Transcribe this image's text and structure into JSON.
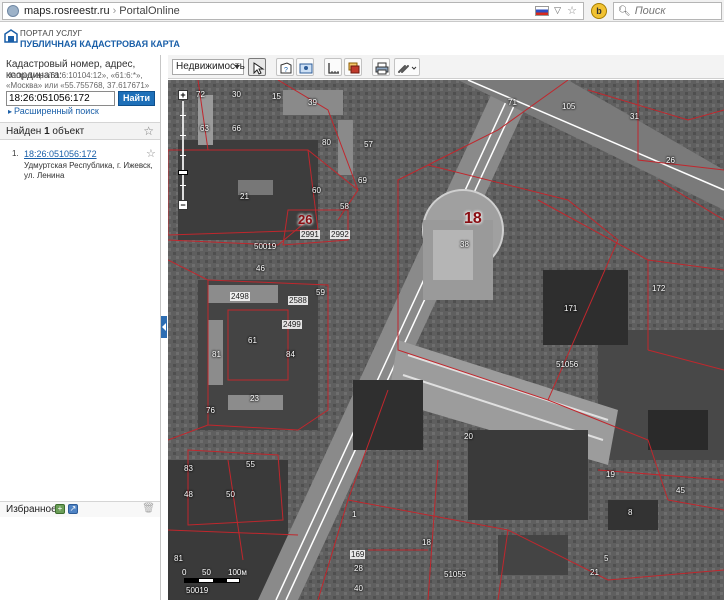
{
  "browser": {
    "url": "maps.rosreestr.ru",
    "page_title": "PortalOnline",
    "search_placeholder": "Поиск"
  },
  "header": {
    "portal_label": "ПОРТАЛ УСЛУГ",
    "title": "ПУБЛИЧНАЯ КАДАСТРОВАЯ КАРТА"
  },
  "search": {
    "hint_title": "Кадастровый номер, адрес, координата:",
    "hint_example": "Например «61:6:10104:12», «61:6:*», «Москва» или «55.755768, 37.617671»",
    "value": "18:26:051056:172",
    "find_label": "Найти",
    "advanced_label": "Расширенный поиск"
  },
  "results": {
    "found_prefix": "Найден",
    "found_count": "1",
    "found_suffix": "объект",
    "items": [
      {
        "num": "1.",
        "cadastral": "18:26:051056:172",
        "address": "Удмуртская Республика, г. Ижевск, ул. Ленина"
      }
    ]
  },
  "favorites": {
    "label": "Избранное"
  },
  "toolbar": {
    "layer_select": "Недвижимость"
  },
  "map": {
    "scale": {
      "l0": "0",
      "l1": "50",
      "l2": "100м"
    },
    "labels": {
      "n72": "72",
      "n30": "30",
      "n15": "15",
      "n39": "39",
      "n71": "71",
      "n105": "105",
      "n31": "31",
      "n63": "63",
      "n66": "66",
      "n80": "80",
      "n57": "57",
      "n26a": "26",
      "n21a": "21",
      "n69": "69",
      "n60": "60",
      "n58": "58",
      "big26": "26",
      "n2991": "2991",
      "n2992": "2992",
      "n50019a": "50019",
      "big18": "18",
      "n38": "38",
      "n46": "46",
      "n2498": "2498",
      "n2588": "2588",
      "n59": "59",
      "n2499": "2499",
      "n81": "81",
      "n61": "61",
      "n84": "84",
      "n76": "76",
      "n23": "23",
      "n171": "171",
      "n172": "172",
      "n51056a": "51056",
      "n20": "20",
      "n19": "19",
      "n45": "45",
      "n8": "8",
      "n83": "83",
      "n55": "55",
      "n48": "48",
      "n50": "50",
      "n1": "1",
      "n18": "18",
      "n169": "169",
      "n28": "28",
      "n40": "40",
      "n81b": "81",
      "n51055": "51055",
      "n50019b": "50019",
      "n5": "5",
      "n21b": "21"
    }
  }
}
